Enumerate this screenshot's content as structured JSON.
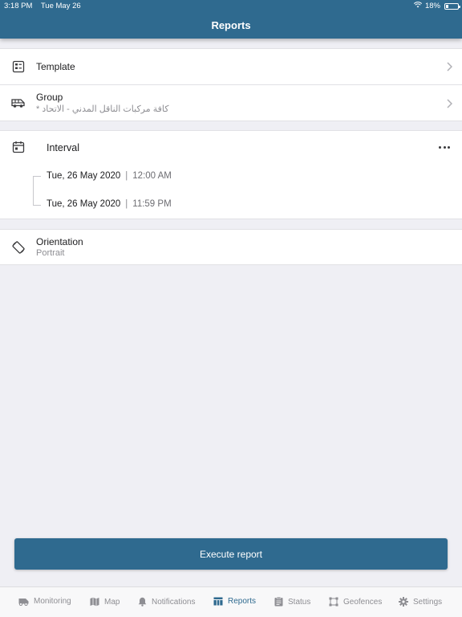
{
  "status_bar": {
    "time": "3:18 PM",
    "date": "Tue May 26",
    "battery": "18%",
    "battery_level": 0.18
  },
  "header": {
    "title": "Reports"
  },
  "template": {
    "label": "Template",
    "icon": "template-icon"
  },
  "group": {
    "label": "Group",
    "value": "* كافة مركبات الناقل المدني - الاتحاد",
    "icon": "vehicle-icon"
  },
  "interval": {
    "label": "Interval",
    "icon": "calendar-icon",
    "from_date": "Tue, 26 May 2020",
    "from_time": "12:00 AM",
    "to_date": "Tue, 26 May 2020",
    "to_time": "11:59 PM",
    "separator": "|"
  },
  "orientation": {
    "label": "Orientation",
    "value": "Portrait",
    "icon": "rotate-icon"
  },
  "execute_button": {
    "label": "Execute report"
  },
  "tabs": [
    {
      "label": "Monitoring",
      "icon": "truck-icon"
    },
    {
      "label": "Map",
      "icon": "map-icon"
    },
    {
      "label": "Notifications",
      "icon": "bell-icon"
    },
    {
      "label": "Reports",
      "icon": "table-icon",
      "active": true
    },
    {
      "label": "Status",
      "icon": "clipboard-icon"
    },
    {
      "label": "Geofences",
      "icon": "geofence-icon"
    },
    {
      "label": "Settings",
      "icon": "gear-icon"
    }
  ],
  "colors": {
    "accent": "#2f6a8f",
    "background": "#efeff4"
  }
}
